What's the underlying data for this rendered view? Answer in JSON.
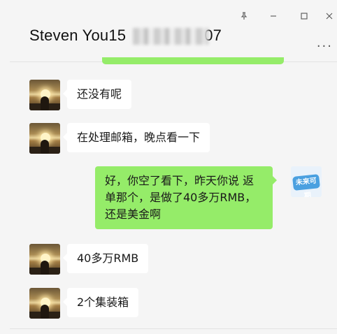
{
  "window": {
    "title": "Steven You15",
    "title_suffix": "07",
    "controls": {
      "pin": "pin-icon",
      "minimize": "minimize-icon",
      "maximize": "maximize-icon",
      "close": "close-icon"
    },
    "more_label": "···"
  },
  "colors": {
    "background": "#f5f5f5",
    "received_bubble": "#ffffff",
    "sent_bubble": "#95ec69"
  },
  "messages": [
    {
      "side": "left",
      "text": "还没有呢"
    },
    {
      "side": "left",
      "text": "在处理邮箱，晚点看一下"
    },
    {
      "side": "right",
      "text": "好，你空了看下，昨天你说 返单那个，是做了40多万RMB，还是美金啊"
    },
    {
      "side": "left",
      "text": "40多万RMB"
    },
    {
      "side": "left",
      "text": "2个集装箱"
    }
  ],
  "me_avatar": {
    "logo_text": "未来可期"
  }
}
